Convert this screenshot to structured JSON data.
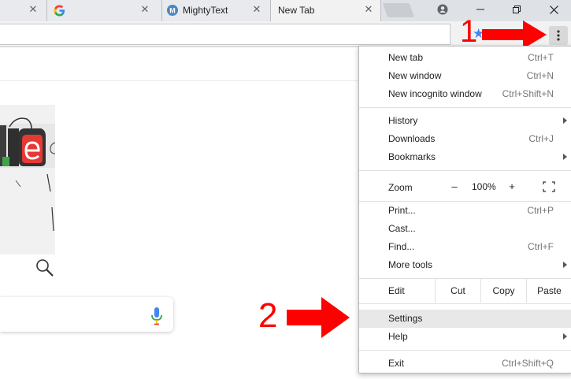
{
  "tabs": [
    {
      "title": "",
      "favicon": "blank-favicon",
      "close": "✕"
    },
    {
      "title": "",
      "favicon": "google-icon",
      "close": "✕"
    },
    {
      "title": "MightyText",
      "favicon": "mightytext-icon",
      "close": "✕"
    },
    {
      "title": "New Tab",
      "favicon": "",
      "close": "✕",
      "active": true
    }
  ],
  "window_controls": {
    "minimize": "minimize-icon",
    "restore": "restore-icon",
    "close": "close-icon"
  },
  "toolbar": {
    "bookmark_star_color": "#4285f4"
  },
  "menu": {
    "items": [
      {
        "label": "New tab",
        "shortcut": "Ctrl+T"
      },
      {
        "label": "New window",
        "shortcut": "Ctrl+N"
      },
      {
        "label": "New incognito window",
        "shortcut": "Ctrl+Shift+N"
      },
      {
        "label": "History",
        "shortcut": ""
      },
      {
        "label": "Downloads",
        "shortcut": "Ctrl+J"
      },
      {
        "label": "Bookmarks",
        "shortcut": ""
      },
      {
        "label": "Print...",
        "shortcut": "Ctrl+P"
      },
      {
        "label": "Cast...",
        "shortcut": ""
      },
      {
        "label": "Find...",
        "shortcut": "Ctrl+F"
      },
      {
        "label": "More tools",
        "shortcut": ""
      },
      {
        "label": "Settings",
        "shortcut": ""
      },
      {
        "label": "Help",
        "shortcut": ""
      },
      {
        "label": "Exit",
        "shortcut": "Ctrl+Shift+Q"
      }
    ],
    "zoom": {
      "label": "Zoom",
      "minus": "–",
      "value": "100%",
      "plus": "+"
    },
    "edit": {
      "label": "Edit",
      "cut": "Cut",
      "copy": "Copy",
      "paste": "Paste"
    },
    "highlighted_item": "Settings"
  },
  "annotations": {
    "step1": "1",
    "step2": "2",
    "color": "#ff0000"
  }
}
